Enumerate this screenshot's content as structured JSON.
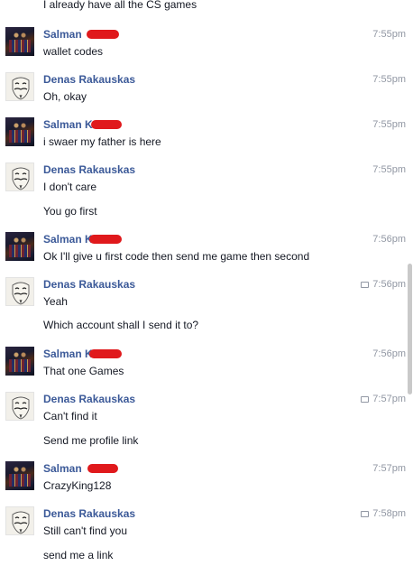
{
  "conversation": {
    "top_partial_line": "I already have all the CS games",
    "messages": [
      {
        "sender": "Salman",
        "avatar": "salman",
        "time": "7:55pm",
        "seen": false,
        "lines": [
          "wallet codes"
        ]
      },
      {
        "sender": "Denas Rakauskas",
        "avatar": "denas",
        "time": "7:55pm",
        "seen": false,
        "lines": [
          "Oh, okay"
        ]
      },
      {
        "sender": "Salman K",
        "avatar": "salman",
        "time": "7:55pm",
        "seen": false,
        "lines": [
          "i swaer my father is here"
        ]
      },
      {
        "sender": "Denas Rakauskas",
        "avatar": "denas",
        "time": "7:55pm",
        "seen": false,
        "lines": [
          "I don't care",
          "You go first"
        ]
      },
      {
        "sender": "Salman K",
        "avatar": "salman",
        "time": "7:56pm",
        "seen": false,
        "lines": [
          "Ok I'll give u first code then send me game then second"
        ]
      },
      {
        "sender": "Denas Rakauskas",
        "avatar": "denas",
        "time": "7:56pm",
        "seen": true,
        "lines": [
          "Yeah",
          "Which account shall I send it to?"
        ]
      },
      {
        "sender": "Salman K",
        "avatar": "salman",
        "time": "7:56pm",
        "seen": false,
        "lines": [
          "That one Games"
        ]
      },
      {
        "sender": "Denas Rakauskas",
        "avatar": "denas",
        "time": "7:57pm",
        "seen": true,
        "lines": [
          "Can't find it",
          "Send me profile link"
        ]
      },
      {
        "sender": "Salman",
        "avatar": "salman",
        "time": "7:57pm",
        "seen": false,
        "lines": [
          "CrazyKing128"
        ]
      },
      {
        "sender": "Denas Rakauskas",
        "avatar": "denas",
        "time": "7:58pm",
        "seen": true,
        "lines": [
          "Still can't find you",
          "send me a link"
        ]
      }
    ]
  },
  "colors": {
    "sender_name": "#3b5998",
    "timestamp": "#9197a3",
    "redaction": "#e0191c"
  }
}
